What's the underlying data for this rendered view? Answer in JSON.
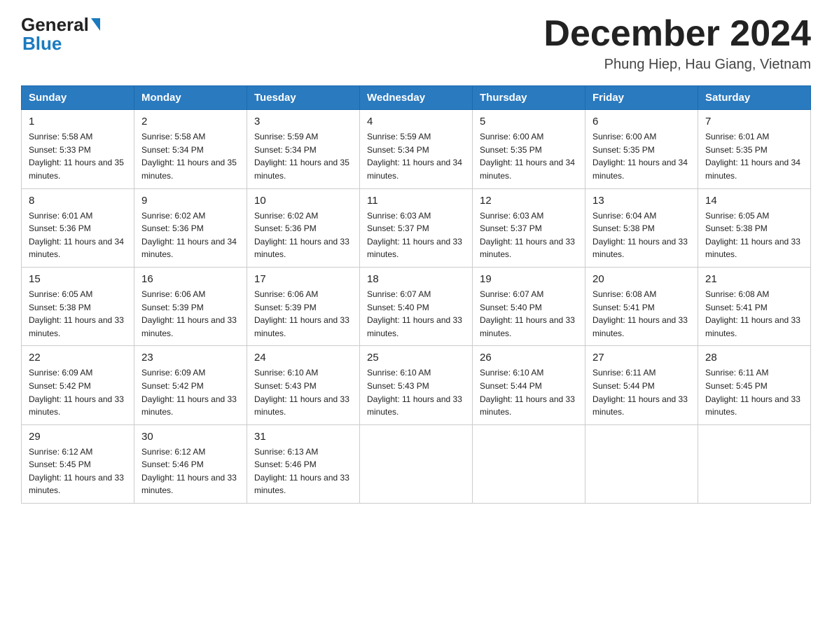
{
  "header": {
    "logo_general": "General",
    "logo_blue": "Blue",
    "title": "December 2024",
    "subtitle": "Phung Hiep, Hau Giang, Vietnam"
  },
  "days_of_week": [
    "Sunday",
    "Monday",
    "Tuesday",
    "Wednesday",
    "Thursday",
    "Friday",
    "Saturday"
  ],
  "weeks": [
    [
      {
        "day": "1",
        "sunrise": "5:58 AM",
        "sunset": "5:33 PM",
        "daylight": "11 hours and 35 minutes."
      },
      {
        "day": "2",
        "sunrise": "5:58 AM",
        "sunset": "5:34 PM",
        "daylight": "11 hours and 35 minutes."
      },
      {
        "day": "3",
        "sunrise": "5:59 AM",
        "sunset": "5:34 PM",
        "daylight": "11 hours and 35 minutes."
      },
      {
        "day": "4",
        "sunrise": "5:59 AM",
        "sunset": "5:34 PM",
        "daylight": "11 hours and 34 minutes."
      },
      {
        "day": "5",
        "sunrise": "6:00 AM",
        "sunset": "5:35 PM",
        "daylight": "11 hours and 34 minutes."
      },
      {
        "day": "6",
        "sunrise": "6:00 AM",
        "sunset": "5:35 PM",
        "daylight": "11 hours and 34 minutes."
      },
      {
        "day": "7",
        "sunrise": "6:01 AM",
        "sunset": "5:35 PM",
        "daylight": "11 hours and 34 minutes."
      }
    ],
    [
      {
        "day": "8",
        "sunrise": "6:01 AM",
        "sunset": "5:36 PM",
        "daylight": "11 hours and 34 minutes."
      },
      {
        "day": "9",
        "sunrise": "6:02 AM",
        "sunset": "5:36 PM",
        "daylight": "11 hours and 34 minutes."
      },
      {
        "day": "10",
        "sunrise": "6:02 AM",
        "sunset": "5:36 PM",
        "daylight": "11 hours and 33 minutes."
      },
      {
        "day": "11",
        "sunrise": "6:03 AM",
        "sunset": "5:37 PM",
        "daylight": "11 hours and 33 minutes."
      },
      {
        "day": "12",
        "sunrise": "6:03 AM",
        "sunset": "5:37 PM",
        "daylight": "11 hours and 33 minutes."
      },
      {
        "day": "13",
        "sunrise": "6:04 AM",
        "sunset": "5:38 PM",
        "daylight": "11 hours and 33 minutes."
      },
      {
        "day": "14",
        "sunrise": "6:05 AM",
        "sunset": "5:38 PM",
        "daylight": "11 hours and 33 minutes."
      }
    ],
    [
      {
        "day": "15",
        "sunrise": "6:05 AM",
        "sunset": "5:38 PM",
        "daylight": "11 hours and 33 minutes."
      },
      {
        "day": "16",
        "sunrise": "6:06 AM",
        "sunset": "5:39 PM",
        "daylight": "11 hours and 33 minutes."
      },
      {
        "day": "17",
        "sunrise": "6:06 AM",
        "sunset": "5:39 PM",
        "daylight": "11 hours and 33 minutes."
      },
      {
        "day": "18",
        "sunrise": "6:07 AM",
        "sunset": "5:40 PM",
        "daylight": "11 hours and 33 minutes."
      },
      {
        "day": "19",
        "sunrise": "6:07 AM",
        "sunset": "5:40 PM",
        "daylight": "11 hours and 33 minutes."
      },
      {
        "day": "20",
        "sunrise": "6:08 AM",
        "sunset": "5:41 PM",
        "daylight": "11 hours and 33 minutes."
      },
      {
        "day": "21",
        "sunrise": "6:08 AM",
        "sunset": "5:41 PM",
        "daylight": "11 hours and 33 minutes."
      }
    ],
    [
      {
        "day": "22",
        "sunrise": "6:09 AM",
        "sunset": "5:42 PM",
        "daylight": "11 hours and 33 minutes."
      },
      {
        "day": "23",
        "sunrise": "6:09 AM",
        "sunset": "5:42 PM",
        "daylight": "11 hours and 33 minutes."
      },
      {
        "day": "24",
        "sunrise": "6:10 AM",
        "sunset": "5:43 PM",
        "daylight": "11 hours and 33 minutes."
      },
      {
        "day": "25",
        "sunrise": "6:10 AM",
        "sunset": "5:43 PM",
        "daylight": "11 hours and 33 minutes."
      },
      {
        "day": "26",
        "sunrise": "6:10 AM",
        "sunset": "5:44 PM",
        "daylight": "11 hours and 33 minutes."
      },
      {
        "day": "27",
        "sunrise": "6:11 AM",
        "sunset": "5:44 PM",
        "daylight": "11 hours and 33 minutes."
      },
      {
        "day": "28",
        "sunrise": "6:11 AM",
        "sunset": "5:45 PM",
        "daylight": "11 hours and 33 minutes."
      }
    ],
    [
      {
        "day": "29",
        "sunrise": "6:12 AM",
        "sunset": "5:45 PM",
        "daylight": "11 hours and 33 minutes."
      },
      {
        "day": "30",
        "sunrise": "6:12 AM",
        "sunset": "5:46 PM",
        "daylight": "11 hours and 33 minutes."
      },
      {
        "day": "31",
        "sunrise": "6:13 AM",
        "sunset": "5:46 PM",
        "daylight": "11 hours and 33 minutes."
      },
      null,
      null,
      null,
      null
    ]
  ]
}
